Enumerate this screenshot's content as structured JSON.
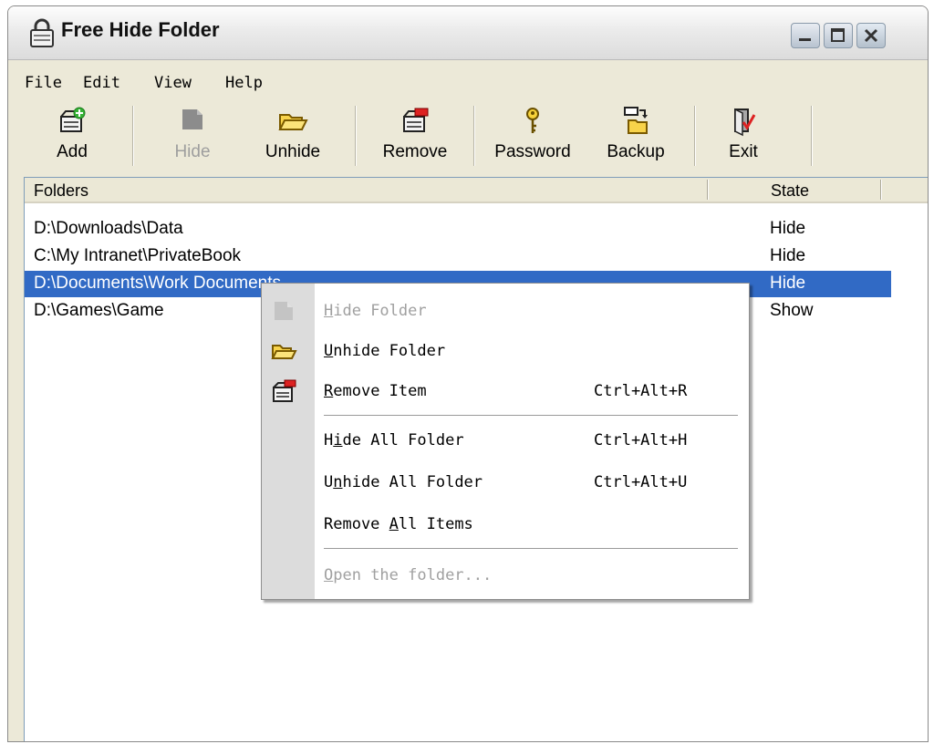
{
  "window": {
    "title": "Free Hide Folder"
  },
  "menubar": {
    "items": [
      {
        "label": "File"
      },
      {
        "label": "Edit"
      },
      {
        "label": "View"
      },
      {
        "label": "Help"
      }
    ]
  },
  "toolbar": {
    "buttons": [
      {
        "label": "Add",
        "icon": "add-folder-icon",
        "enabled": true
      },
      {
        "label": "Hide",
        "icon": "hide-folder-icon",
        "enabled": false
      },
      {
        "label": "Unhide",
        "icon": "open-folder-icon",
        "enabled": true
      },
      {
        "label": "Remove",
        "icon": "remove-folder-icon",
        "enabled": true
      },
      {
        "label": "Password",
        "icon": "key-icon",
        "enabled": true
      },
      {
        "label": "Backup",
        "icon": "backup-icon",
        "enabled": true
      },
      {
        "label": "Exit",
        "icon": "exit-door-icon",
        "enabled": true
      }
    ]
  },
  "list": {
    "columns": [
      "Folders",
      "State"
    ],
    "rows": [
      {
        "folder": "D:\\Downloads\\Data",
        "state": "Hide"
      },
      {
        "folder": "C:\\My Intranet\\PrivateBook",
        "state": "Hide"
      },
      {
        "folder": "D:\\Documents\\Work Documents",
        "state": "Hide",
        "selected": true
      },
      {
        "folder": "D:\\Games\\Game",
        "state": "Show"
      }
    ]
  },
  "context_menu": {
    "items": [
      {
        "mnemonic": "H",
        "rest": "ide Folder",
        "shortcut": "",
        "enabled": false,
        "icon": "hide-folder-icon"
      },
      {
        "mnemonic": "U",
        "rest": "nhide Folder",
        "shortcut": "",
        "enabled": true,
        "icon": "open-folder-icon"
      },
      {
        "mnemonic": "R",
        "rest": "emove Item",
        "shortcut": "Ctrl+Alt+R",
        "enabled": true,
        "icon": "remove-folder-icon"
      },
      {
        "pre": "H",
        "mnemonic": "i",
        "rest": "de All Folder",
        "shortcut": "Ctrl+Alt+H",
        "enabled": true
      },
      {
        "pre": "U",
        "mnemonic": "n",
        "rest": "hide All Folder",
        "shortcut": "Ctrl+Alt+U",
        "enabled": true
      },
      {
        "pre": "Remove ",
        "mnemonic": "A",
        "rest": "ll Items",
        "shortcut": "",
        "enabled": true
      },
      {
        "mnemonic": "O",
        "rest": "pen the folder...",
        "shortcut": "",
        "enabled": false
      }
    ]
  },
  "colors": {
    "selection": "#316ac5",
    "window_face": "#ece9d8"
  }
}
